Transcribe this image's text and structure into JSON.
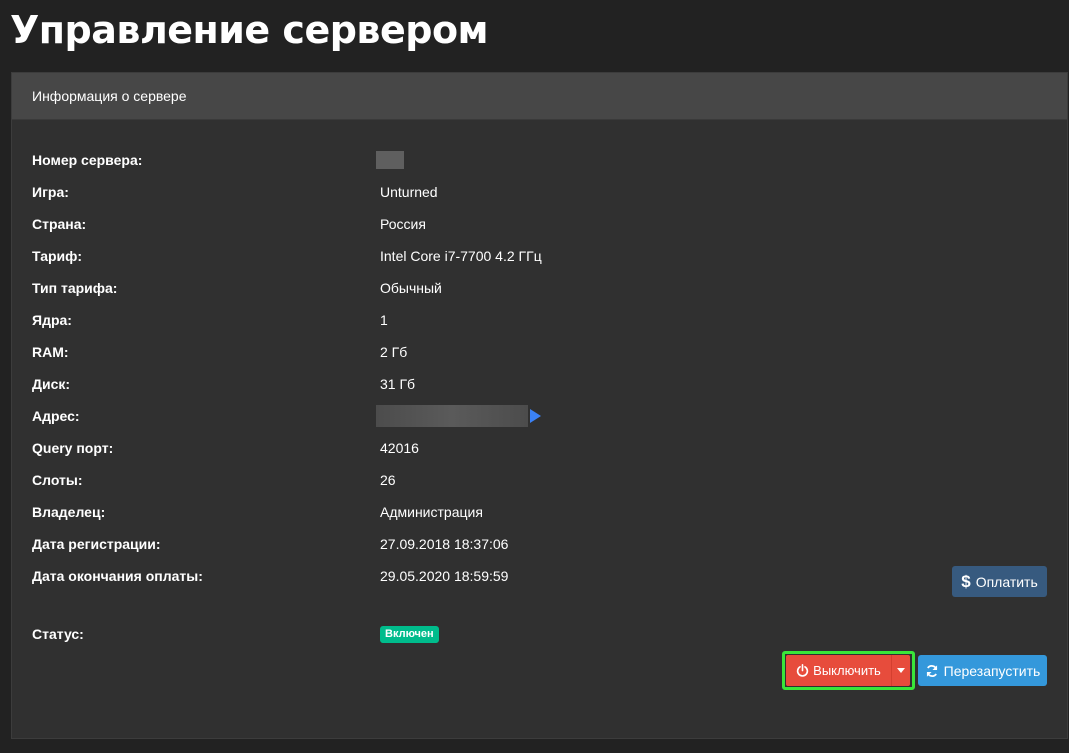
{
  "page": {
    "title": "Управление сервером"
  },
  "panel": {
    "heading": "Информация о сервере",
    "rows": [
      {
        "label": "Номер сервера:",
        "value": ""
      },
      {
        "label": "Игра:",
        "value": "Unturned"
      },
      {
        "label": "Страна:",
        "value": "Россия"
      },
      {
        "label": "Тариф:",
        "value": "Intel Core i7-7700 4.2 ГГц"
      },
      {
        "label": "Тип тарифа:",
        "value": "Обычный"
      },
      {
        "label": "Ядра:",
        "value": "1"
      },
      {
        "label": "RAM:",
        "value": "2 Гб"
      },
      {
        "label": "Диск:",
        "value": "31 Гб"
      },
      {
        "label": "Адрес:",
        "value": ""
      },
      {
        "label": "Query порт:",
        "value": "42016"
      },
      {
        "label": "Слоты:",
        "value": "26"
      },
      {
        "label": "Владелец:",
        "value": "Администрация"
      },
      {
        "label": "Дата регистрации:",
        "value": "27.09.2018 18:37:06"
      },
      {
        "label": "Дата окончания оплаты:",
        "value": "29.05.2020 18:59:59"
      }
    ],
    "status": {
      "label": "Статус:",
      "badge": "Включен",
      "badge_color": "#00bc8c"
    }
  },
  "buttons": {
    "pay": {
      "label": "Оплатить",
      "icon": "dollar-icon",
      "color": "#375a7f"
    },
    "power_off": {
      "label": "Выключить",
      "icon": "power-icon",
      "color": "#e74c3c"
    },
    "restart": {
      "label": "Перезапустить",
      "icon": "refresh-icon",
      "color": "#3498db"
    }
  },
  "colors": {
    "background": "#222222",
    "panel": "#303030",
    "panel_heading": "#474747",
    "highlight": "#39e639"
  }
}
